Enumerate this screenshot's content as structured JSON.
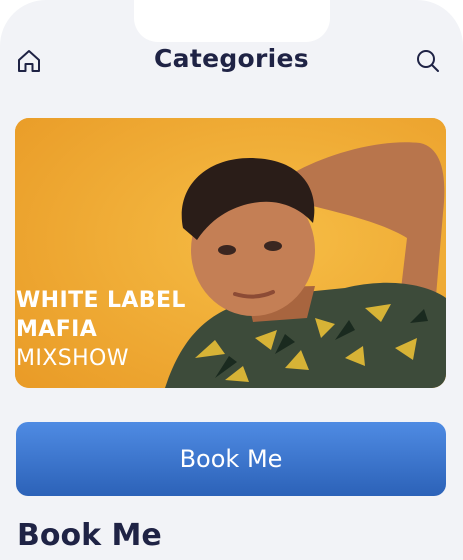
{
  "header": {
    "title": "Categories",
    "left_icon": "home-icon",
    "right_icon": "search-icon"
  },
  "hero": {
    "line1": "WHITE LABEL",
    "line2": "MAFIA",
    "line3": "MIXSHOW",
    "background_color": "#f0ae36"
  },
  "cta": {
    "label": "Book Me",
    "color": "#3a75cf"
  },
  "section": {
    "heading": "Book Me"
  }
}
